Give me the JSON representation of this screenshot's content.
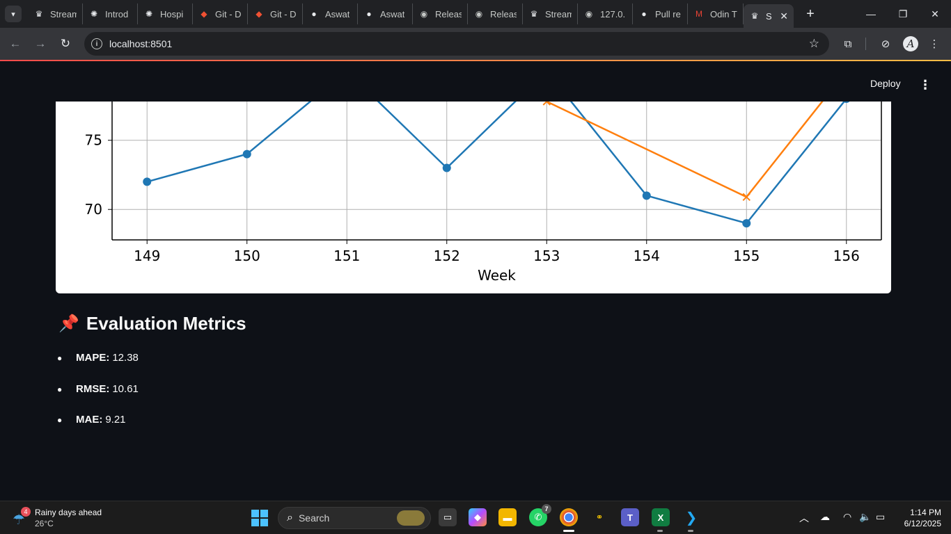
{
  "browser": {
    "tabs": [
      {
        "title": "Stream",
        "icon": "streamlit-crown-icon"
      },
      {
        "title": "Introd",
        "icon": "openai-icon"
      },
      {
        "title": "Hospi",
        "icon": "openai-icon"
      },
      {
        "title": "Git - D",
        "icon": "git-icon"
      },
      {
        "title": "Git - D",
        "icon": "git-icon"
      },
      {
        "title": "Aswat",
        "icon": "github-icon"
      },
      {
        "title": "Aswat",
        "icon": "github-icon"
      },
      {
        "title": "Releas",
        "icon": "globe-icon"
      },
      {
        "title": "Releas",
        "icon": "globe-icon"
      },
      {
        "title": "Stream",
        "icon": "streamlit-crown-icon"
      },
      {
        "title": "127.0.",
        "icon": "globe-icon"
      },
      {
        "title": "Pull re",
        "icon": "github-icon"
      },
      {
        "title": "Odin T",
        "icon": "gmail-icon"
      }
    ],
    "active_tab": {
      "title": "St",
      "icon": "streamlit-crown-icon"
    },
    "url": "localhost:8501"
  },
  "app": {
    "deploy_label": "Deploy",
    "metrics": {
      "title": "Evaluation Metrics",
      "items": [
        {
          "name": "MAPE:",
          "value": "12.38"
        },
        {
          "name": "RMSE:",
          "value": "10.61"
        },
        {
          "name": "MAE:",
          "value": "9.21"
        }
      ]
    }
  },
  "chart_data": {
    "type": "line",
    "xlabel": "Week",
    "ylabel": "",
    "x": [
      149,
      150,
      151,
      152,
      153,
      154,
      155,
      156
    ],
    "ylim_visible": [
      67.8,
      77.8
    ],
    "yticks": [
      70,
      75
    ],
    "grid": true,
    "colors": {
      "series1": "#1f77b4",
      "series2": "#ff7f0e"
    },
    "series": [
      {
        "values": [
          72,
          74,
          80,
          73,
          80,
          71,
          69,
          78
        ],
        "marker": "circle"
      },
      {
        "values": [
          null,
          null,
          null,
          null,
          77.8,
          null,
          70.9,
          80
        ],
        "marker": "x"
      }
    ]
  },
  "taskbar": {
    "weather_text": "Rainy days ahead",
    "weather_temp": "26°C",
    "weather_badge": "4",
    "search_label": "Search",
    "whatsapp_badge": "7",
    "time": "1:14 PM",
    "date": "6/12/2025"
  }
}
